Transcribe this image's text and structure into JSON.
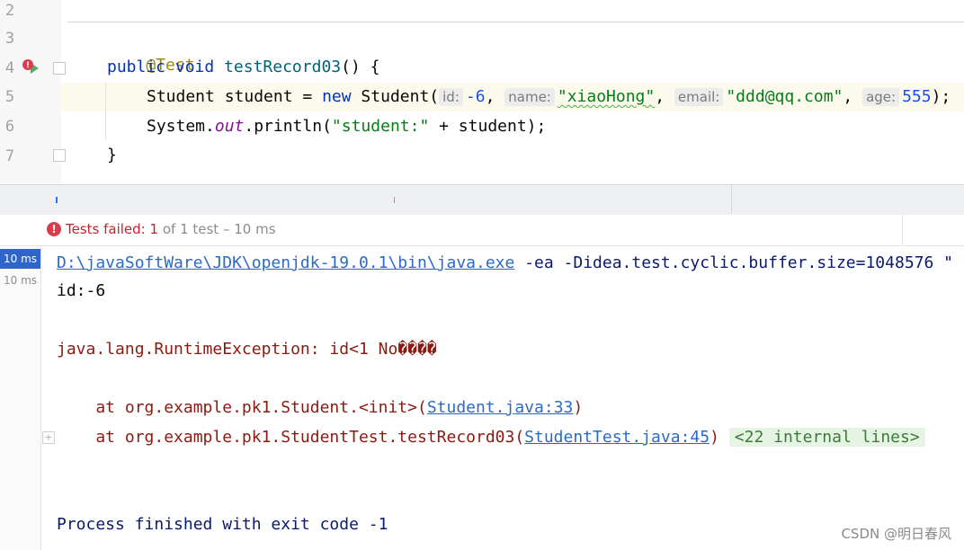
{
  "editor": {
    "line_numbers": [
      "2",
      "3",
      "4",
      "5",
      "6",
      "7"
    ],
    "annotation": "@Test",
    "method": {
      "kw_public": "public",
      "kw_void": "void",
      "name": "testRecord03",
      "rest": "() {"
    },
    "statement1": {
      "type": "Student",
      "var": " student = ",
      "kw_new": "new",
      "ctor": " Student(",
      "hints": [
        {
          "label": "id:",
          "value": "-6"
        },
        {
          "label": "name:",
          "value": "\"xiaoHong\""
        },
        {
          "label": "email:",
          "value": "\"ddd@qq.com\""
        },
        {
          "label": "age:",
          "value": "555"
        }
      ],
      "close": ");"
    },
    "statement2": {
      "prefix": "System.",
      "field": "out",
      "call": ".println(",
      "str": "\"student:\"",
      "rest": " + student);"
    },
    "closing_brace": "}"
  },
  "status": {
    "failed_label": "Tests failed:",
    "failed_count": "1",
    "of_text": "of 1 test – 10 ms"
  },
  "sidebar": {
    "selected_time": "10 ms",
    "second_time": "10 ms"
  },
  "console": {
    "cmd_link": "D:\\javaSoftWare\\JDK\\openjdk-19.0.1\\bin\\java.exe",
    "cmd_rest": " -ea -Didea.test.cyclic.buffer.size=1048576 \"",
    "out1": "id:-6",
    "exception": "java.lang.RuntimeException: id<1 No����",
    "stack1_prefix": "    at org.example.pk1.Student.<init>(",
    "stack1_link": "Student.java:33",
    "stack1_suffix": ")",
    "stack2_prefix": "    at org.example.pk1.StudentTest.testRecord03(",
    "stack2_link": "StudentTest.java:45",
    "stack2_suffix": ")",
    "internal_lines": "<22 internal lines>",
    "exit_text": "Process finished with exit code -1"
  },
  "watermark": "CSDN @明日春风",
  "colors": {
    "keyword": "#0033b3",
    "string": "#067d17",
    "number": "#1750eb",
    "error": "#8c1a10",
    "link": "#2a6bc8",
    "selected": "#2f65ca"
  }
}
